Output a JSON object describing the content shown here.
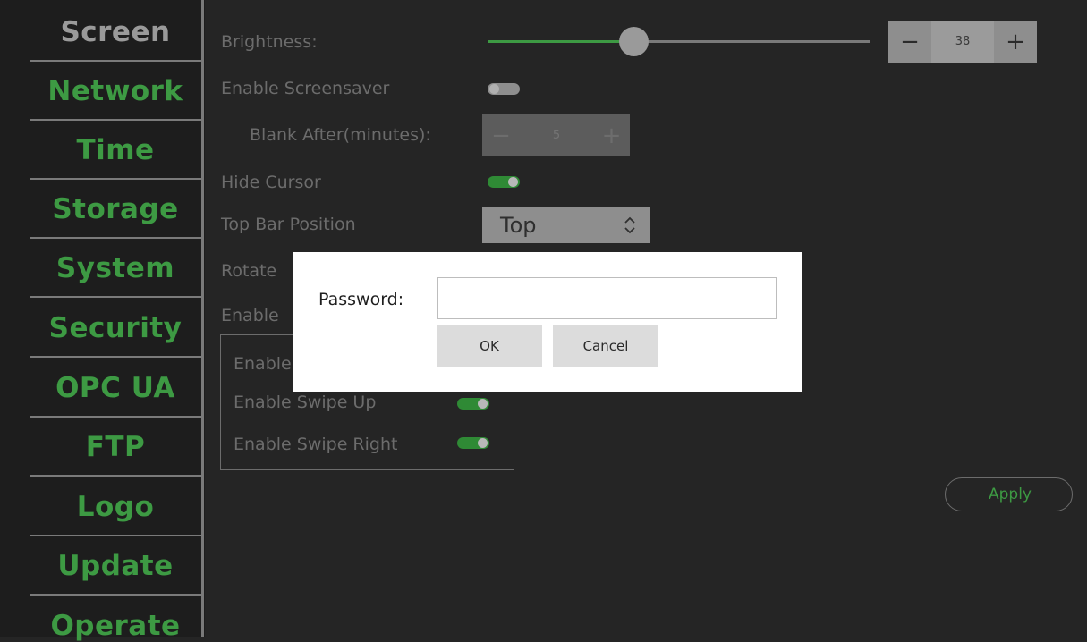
{
  "sidebar": {
    "items": [
      {
        "label": "Screen",
        "active": true
      },
      {
        "label": "Network"
      },
      {
        "label": "Time"
      },
      {
        "label": "Storage"
      },
      {
        "label": "System"
      },
      {
        "label": "Security"
      },
      {
        "label": "OPC UA"
      },
      {
        "label": "FTP"
      },
      {
        "label": "Logo"
      },
      {
        "label": "Update"
      },
      {
        "label": "Operate"
      }
    ]
  },
  "screen": {
    "brightness": {
      "label": "Brightness:",
      "value": "38",
      "fraction": 0.38,
      "minus": "−",
      "plus": "+"
    },
    "screensaver": {
      "label": "Enable Screensaver",
      "on": false
    },
    "blank_after": {
      "label": "Blank After(minutes):",
      "value": "5",
      "minus": "−",
      "plus": "+"
    },
    "hide_cursor": {
      "label": "Hide Cursor",
      "on": true
    },
    "top_bar_position": {
      "label": "Top Bar Position",
      "value": "Top"
    },
    "rotate": {
      "label": "Rotate"
    },
    "enable_partial": {
      "label": "Enable"
    },
    "swipe": {
      "enable_partial": {
        "label": "Enable"
      },
      "swipe_up": {
        "label": "Enable Swipe Up",
        "on": true
      },
      "swipe_right": {
        "label": "Enable Swipe Right",
        "on": true
      }
    },
    "apply_label": "Apply"
  },
  "dialog": {
    "password_label": "Password:",
    "password_value": "",
    "ok_label": "OK",
    "cancel_label": "Cancel"
  },
  "colors": {
    "accent": "#3d9a43",
    "background": "#252525",
    "sidebar_bg": "#1d1d1d"
  }
}
